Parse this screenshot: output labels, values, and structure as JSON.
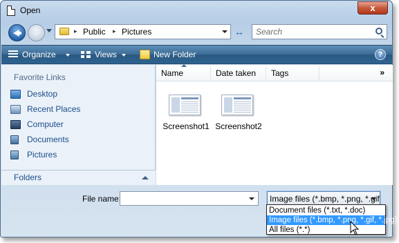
{
  "window": {
    "title": "Open",
    "close_glyph": "x"
  },
  "navigation": {
    "address": {
      "crumbs": [
        "Public",
        "Pictures"
      ],
      "separator_glyph": "▸"
    },
    "search": {
      "placeholder": "Search"
    },
    "refresh_glyph": "↔"
  },
  "toolbar": {
    "organize_label": "Organize",
    "views_label": "Views",
    "new_folder_label": "New Folder",
    "help_glyph": "?"
  },
  "left_pane": {
    "favorites_header": "Favorite Links",
    "items": [
      {
        "label": "Desktop",
        "icon": "desktop-icon"
      },
      {
        "label": "Recent Places",
        "icon": "recent-places-icon"
      },
      {
        "label": "Computer",
        "icon": "computer-icon"
      },
      {
        "label": "Documents",
        "icon": "documents-icon"
      },
      {
        "label": "Pictures",
        "icon": "pictures-icon"
      }
    ],
    "folders_label": "Folders"
  },
  "file_list": {
    "columns": [
      "Name",
      "Date taken",
      "Tags"
    ],
    "more_glyph": "»",
    "files": [
      {
        "name": "Screenshot1"
      },
      {
        "name": "Screenshot2"
      }
    ]
  },
  "footer": {
    "file_name_label": "File name:",
    "file_name_value": "",
    "file_type_selected": "Image files (*.bmp, *.png, *.gif",
    "file_type_options": [
      "Document files (*.txt, *.doc)",
      "Image files (*.bmp, *.png, *.gif, *.jpg)",
      "All files (*.*)"
    ],
    "highlighted_option_index": 1
  },
  "colors": {
    "toolbar": "#295982",
    "link_text": "#1a4d8a",
    "selection": "#3399ff",
    "close_button": "#c75a3c"
  }
}
